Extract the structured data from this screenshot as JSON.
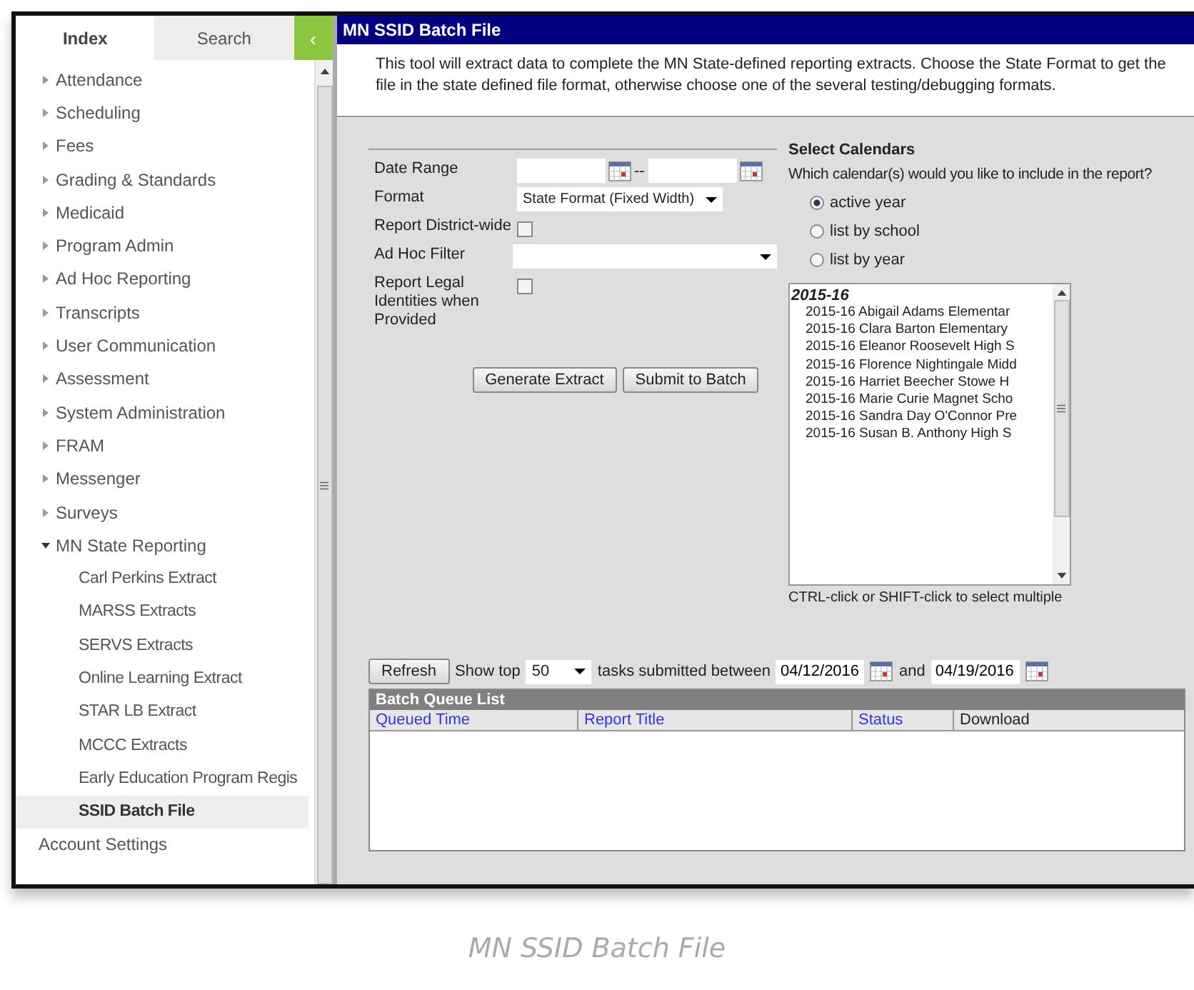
{
  "sidebar": {
    "tabs": [
      {
        "label": "Index",
        "selected": true
      },
      {
        "label": "Search",
        "selected": false
      }
    ],
    "collapse_button": "‹",
    "items": [
      {
        "label": "Attendance",
        "expanded": false,
        "selected": false
      },
      {
        "label": "Scheduling",
        "expanded": false,
        "selected": false
      },
      {
        "label": "Fees",
        "expanded": false,
        "selected": false
      },
      {
        "label": "Grading & Standards",
        "expanded": false,
        "selected": false
      },
      {
        "label": "Medicaid",
        "expanded": false,
        "selected": false
      },
      {
        "label": "Program Admin",
        "expanded": false,
        "selected": false
      },
      {
        "label": "Ad Hoc Reporting",
        "expanded": false,
        "selected": false
      },
      {
        "label": "Transcripts",
        "expanded": false,
        "selected": false
      },
      {
        "label": "User Communication",
        "expanded": false,
        "selected": false
      },
      {
        "label": "Assessment",
        "expanded": false,
        "selected": false
      },
      {
        "label": "System Administration",
        "expanded": false,
        "selected": false
      },
      {
        "label": "FRAM",
        "expanded": false,
        "selected": false
      },
      {
        "label": "Messenger",
        "expanded": false,
        "selected": false
      },
      {
        "label": "Surveys",
        "expanded": false,
        "selected": false
      },
      {
        "label": "MN State Reporting",
        "expanded": true,
        "selected": false,
        "children": [
          {
            "label": "Carl Perkins Extract",
            "selected": false
          },
          {
            "label": "MARSS Extracts",
            "selected": false
          },
          {
            "label": "SERVS Extracts",
            "selected": false
          },
          {
            "label": "Online Learning Extract",
            "selected": false
          },
          {
            "label": "STAR LB Extract",
            "selected": false
          },
          {
            "label": "MCCC Extracts",
            "selected": false
          },
          {
            "label": "Early Education Program Regis",
            "selected": false
          },
          {
            "label": "SSID Batch File",
            "selected": true
          }
        ]
      }
    ],
    "footer_item": "Account Settings"
  },
  "window": {
    "title": "MN SSID Batch File",
    "description": "This tool will extract data to complete the MN State-defined reporting extracts. Choose the State Format to get the file in the state defined file format, otherwise choose one of the several testing/debugging formats."
  },
  "form": {
    "date_range": {
      "label": "Date Range",
      "separator": "--"
    },
    "format": {
      "label": "Format",
      "value": "State Format (Fixed Width)"
    },
    "district_wide": {
      "label": "Report District-wide",
      "checked": false
    },
    "ad_hoc_filter": {
      "label": "Ad Hoc Filter"
    },
    "legal_identities": {
      "label": "Report Legal Identities when Provided",
      "checked": false
    },
    "buttons": [
      "Generate Extract",
      "Submit to Batch"
    ]
  },
  "calendars": {
    "title": "Select Calendars",
    "question": "Which calendar(s) would you like to include in the report?",
    "options": [
      {
        "label": "active year",
        "selected": true
      },
      {
        "label": "list by school",
        "selected": false
      },
      {
        "label": "list by year",
        "selected": false
      }
    ],
    "group": "2015-16",
    "items": [
      "2015-16 Abigail Adams Elementar",
      "2015-16 Clara Barton Elementary",
      "2015-16 Eleanor Roosevelt High S",
      "2015-16 Florence Nightingale Midd",
      "2015-16 Harriet Beecher Stowe H",
      "2015-16 Marie Curie Magnet Scho",
      "2015-16 Sandra Day O'Connor Pre",
      "2015-16 Susan B. Anthony High S"
    ],
    "hint": "CTRL-click or SHIFT-click to select multiple"
  },
  "batch": {
    "refresh": "Refresh",
    "show_top": "Show top",
    "count": "50",
    "between": "tasks submitted between",
    "start": "04/12/2016",
    "and": "and",
    "end": "04/19/2016",
    "table_title": "Batch Queue List",
    "columns": [
      {
        "label": "Queued Time",
        "kind": "link"
      },
      {
        "label": "Report Title",
        "kind": "link"
      },
      {
        "label": "Status",
        "kind": "link"
      },
      {
        "label": "Download",
        "kind": "plain"
      }
    ]
  },
  "caption": "MN SSID Batch File"
}
